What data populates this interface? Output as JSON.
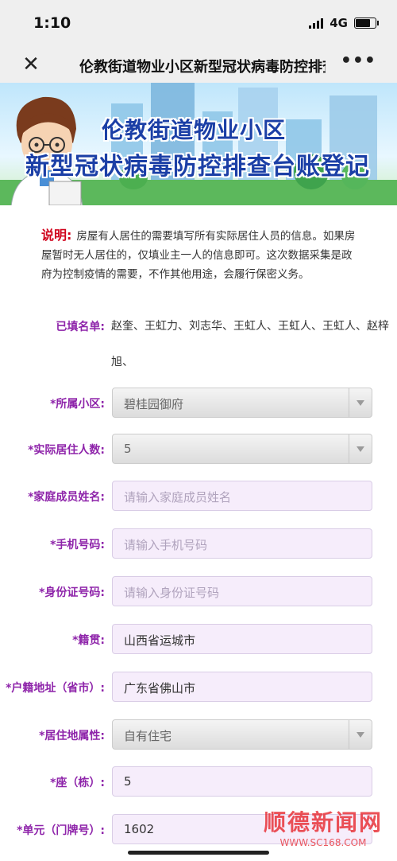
{
  "status_bar": {
    "time": "1:10",
    "network": "4G"
  },
  "nav": {
    "close_icon": "close-icon",
    "title": "伦教街道物业小区新型冠状病毒防控排查台账登记",
    "more_icon": "more-icon"
  },
  "banner": {
    "title_line1": "伦教街道物业小区",
    "title_line2": "新型冠状病毒防控排查台账登记"
  },
  "intro": {
    "label": "说明:",
    "text": "房屋有人居住的需要填写所有实际居住人员的信息。如果房屋暂时无人居住的，仅填业主一人的信息即可。这次数据采集是政府为控制疫情的需要，不作其他用途，会履行保密义务。"
  },
  "filled": {
    "label": "已填名单:",
    "names": "赵奎、王虹力、刘志华、王虹人、王虹人、王虹人、赵梓旭、"
  },
  "form": {
    "community": {
      "label": "*所属小区:",
      "value": "碧桂园御府"
    },
    "residents": {
      "label": "*实际居住人数:",
      "value": "5"
    },
    "member_name": {
      "label": "*家庭成员姓名:",
      "placeholder": "请输入家庭成员姓名"
    },
    "phone": {
      "label": "*手机号码:",
      "placeholder": "请输入手机号码"
    },
    "id_number": {
      "label": "*身份证号码:",
      "placeholder": "请输入身份证号码"
    },
    "native_place": {
      "label": "*籍贯:",
      "value": "山西省运城市"
    },
    "household": {
      "label": "*户籍地址（省市）:",
      "value": "广东省佛山市"
    },
    "residence_type": {
      "label": "*居住地属性:",
      "value": "自有住宅"
    },
    "building": {
      "label": "*座（栋）:",
      "value": "5"
    },
    "unit": {
      "label": "*单元（门牌号）:",
      "value": "1602"
    }
  },
  "watermark": {
    "name": "顺德新闻网",
    "url": "WWW.SC168.COM"
  }
}
